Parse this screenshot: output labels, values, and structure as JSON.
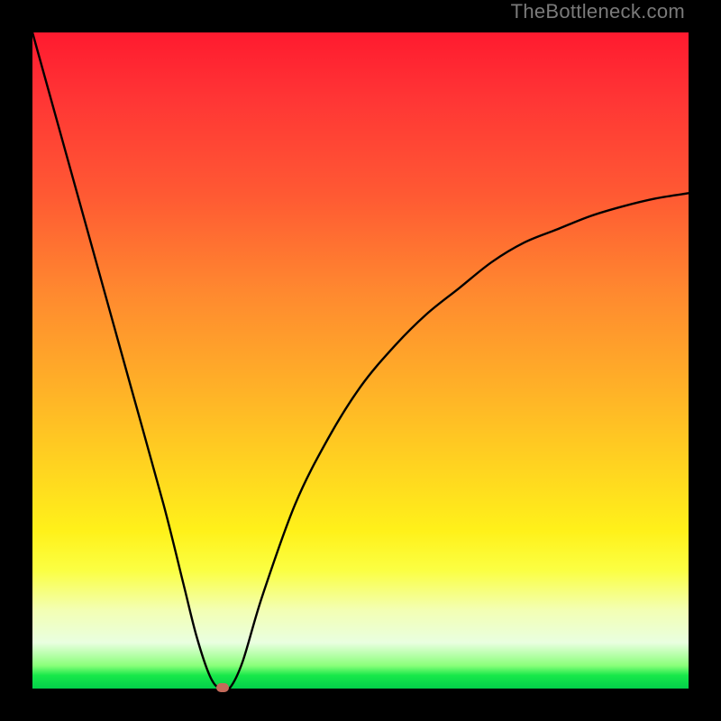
{
  "watermark": "TheBottleneck.com",
  "colors": {
    "frame": "#000000",
    "curve": "#000000",
    "marker": "#c46a5a",
    "gradient_top": "#ff1a2f",
    "gradient_bottom": "#03d04a"
  },
  "chart_data": {
    "type": "line",
    "title": "",
    "xlabel": "",
    "ylabel": "",
    "xlim": [
      0,
      100
    ],
    "ylim": [
      0,
      100
    ],
    "series": [
      {
        "name": "bottleneck-curve",
        "x": [
          0,
          5,
          10,
          15,
          20,
          23,
          25,
          27,
          28.5,
          30,
          32,
          35,
          40,
          45,
          50,
          55,
          60,
          65,
          70,
          75,
          80,
          85,
          90,
          95,
          100
        ],
        "values": [
          100,
          82,
          64,
          46,
          28,
          16,
          8,
          2,
          0,
          0,
          4,
          14,
          28,
          38,
          46,
          52,
          57,
          61,
          65,
          68,
          70,
          72,
          73.5,
          74.7,
          75.5
        ]
      }
    ],
    "marker": {
      "x": 29,
      "y": 0
    }
  }
}
